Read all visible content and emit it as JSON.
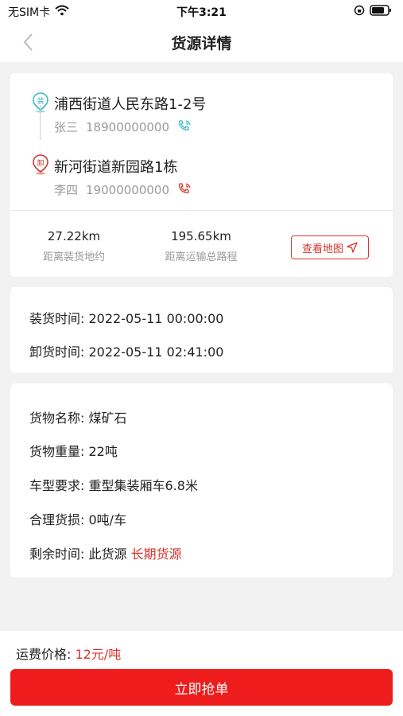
{
  "status_bar": {
    "carrier": "无SIM卡",
    "time": "下午3:21"
  },
  "nav": {
    "title": "货源详情"
  },
  "route": {
    "load": {
      "address": "浦西街道人民东路1-2号",
      "name": "张三",
      "phone": "18900000000",
      "pin_label": "装",
      "color": "#3bb6c9"
    },
    "unload": {
      "address": "新河街道新园路1栋",
      "name": "李四",
      "phone": "19000000000",
      "pin_label": "卸",
      "color": "#d9332b"
    },
    "stats": {
      "distance_to_load_value": "27.22km",
      "distance_to_load_label": "距离装货地约",
      "total_distance_value": "195.65km",
      "total_distance_label": "距离运输总路程"
    },
    "map_button_label": "查看地图"
  },
  "times": {
    "load_label": "装货时间:",
    "load_value": "2022-05-11 00:00:00",
    "unload_label": "卸货时间:",
    "unload_value": "2022-05-11 02:41:00"
  },
  "goods": {
    "name_label": "货物名称:",
    "name_value": "煤矿石",
    "weight_label": "货物重量:",
    "weight_value": "22吨",
    "vehicle_label": "车型要求:",
    "vehicle_value": "重型集装厢车6.8米",
    "loss_label": "合理货损:",
    "loss_value": "0吨/车",
    "remain_label": "剩余时间:",
    "remain_prefix": "此货源",
    "remain_value": "长期货源"
  },
  "footer": {
    "price_label": "运费价格:",
    "price_value": "12元/吨",
    "grab_button": "立即抢单"
  },
  "colors": {
    "accent_red": "#d9332b",
    "button_red": "#ee1c1c",
    "phone_teal": "#3bb6c9"
  }
}
